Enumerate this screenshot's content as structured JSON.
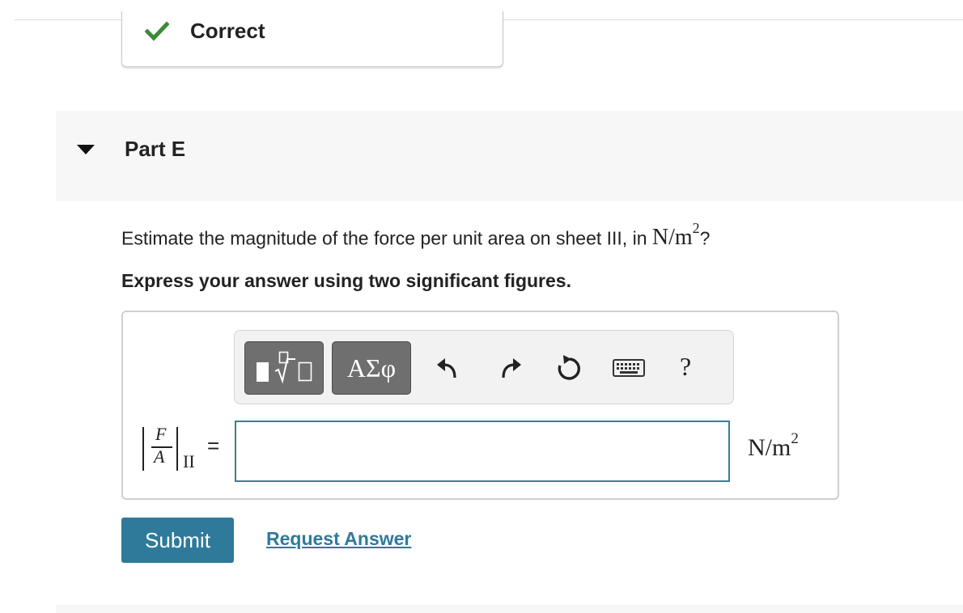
{
  "feedback": {
    "status_text": "Correct",
    "status_color": "#3a8a3a",
    "icon": "check-icon"
  },
  "part": {
    "title": "Part E",
    "toggle_icon": "triangle-down-icon"
  },
  "question": {
    "prompt": "Estimate the magnitude of the force per unit area on sheet III, in ",
    "unit_base": "N/m",
    "unit_exp": "2",
    "suffix": "?",
    "instruction": "Express your answer using two significant figures."
  },
  "toolbar": {
    "template_button_icon": "templates-icon",
    "greek_button_label": "ΑΣφ",
    "undo_icon": "undo-icon",
    "redo_icon": "redo-icon",
    "reset_icon": "reset-icon",
    "keyboard_icon": "keyboard-icon",
    "help_label": "?"
  },
  "answer": {
    "label_numerator": "F",
    "label_denominator": "A",
    "label_subscript": "II",
    "equals": "=",
    "value": "",
    "unit_base": "N/m",
    "unit_exp": "2"
  },
  "actions": {
    "submit_label": "Submit",
    "request_answer_label": "Request Answer"
  },
  "colors": {
    "accent": "#2f7a9a",
    "input_border": "#3d7d95",
    "toolbar_button": "#6f6f6f"
  }
}
